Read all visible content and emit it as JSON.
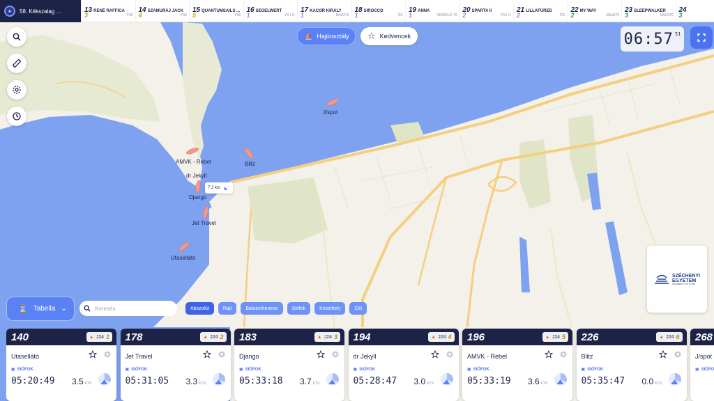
{
  "race": {
    "name": "58. Kékszalag ..."
  },
  "ranking": [
    {
      "rank": "13",
      "name": "RENÉ RAFFICA",
      "sub": "3",
      "sub_color": "#d0a420",
      "cls": "YS0"
    },
    {
      "rank": "14",
      "name": "SZAMURÁJ JACK",
      "sub": "4",
      "sub_color": "#d0a420",
      "cls": "YS0"
    },
    {
      "rank": "15",
      "name": "QUANTUMSAILS ...",
      "sub": "5",
      "sub_color": "#d0a420",
      "cls": "YS0"
    },
    {
      "rank": "16",
      "name": "SEGELWERT",
      "sub": "1",
      "sub_color": "#c470d8",
      "cls": "YS I./1"
    },
    {
      "rank": "17",
      "name": "KACOR KIRÁLY",
      "sub": "1",
      "sub_color": "#c470d8",
      "cls": "NAU370"
    },
    {
      "rank": "18",
      "name": "SIROCCO",
      "sub": "1",
      "sub_color": "#c470d8",
      "cls": "ÖC"
    },
    {
      "rank": "19",
      "name": "ANNA",
      "sub": "1",
      "sub_color": "#c470d8",
      "cls": "CIRKÁLÓ-70"
    },
    {
      "rank": "20",
      "name": "SPARTA II",
      "sub": "2",
      "sub_color": "#c470d8",
      "cls": "YS I./1"
    },
    {
      "rank": "21",
      "name": "LILLAFÜRED",
      "sub": "2",
      "sub_color": "#c470d8",
      "cls": "ÖC"
    },
    {
      "rank": "22",
      "name": "MY WAY",
      "sub": "2",
      "sub_color": "#2a9a4a",
      "cls": "NAU370"
    },
    {
      "rank": "23",
      "name": "SLEEPWALKER",
      "sub": "3",
      "sub_color": "#2a9a4a",
      "cls": "NAU370"
    },
    {
      "rank": "24",
      "name": "",
      "sub": "3",
      "sub_color": "#2a9a4a",
      "cls": ""
    }
  ],
  "controls": {
    "search_icon": "search-icon",
    "ruler_icon": "ruler-icon",
    "settings_icon": "gear-icon",
    "history_icon": "history-icon"
  },
  "top_buttons": {
    "class_label": "Hajóosztály",
    "favorites_label": "Kedvencek"
  },
  "clock": {
    "time": "06:57",
    "seconds": "51"
  },
  "map": {
    "boats": [
      {
        "label": "J/spot"
      },
      {
        "label": "AMVK - Rebel"
      },
      {
        "label": "Blitz"
      },
      {
        "label": "dr Jekyll"
      },
      {
        "label": "Django"
      },
      {
        "label": "Jet Travel"
      },
      {
        "label": "Utasellátó"
      }
    ],
    "speed_tooltip": "7.2 kts"
  },
  "sponsor": {
    "line1": "SZÉCHENYI",
    "line2": "EGYETEM",
    "line3": "UNIVERSITY OF GYŐR"
  },
  "filter": {
    "table_label": "Tabella",
    "search_placeholder": "Keresés",
    "chips": [
      {
        "label": "Abszolút",
        "active": true
      },
      {
        "label": "Rajt",
        "active": false
      },
      {
        "label": "Balatonkenese",
        "active": false
      },
      {
        "label": "Siófok",
        "active": false
      },
      {
        "label": "Keszthely",
        "active": false
      },
      {
        "label": "Cél",
        "active": false
      }
    ]
  },
  "cards": [
    {
      "sail": "140",
      "cls": "J24",
      "pos": "1",
      "name": "Utasellátó",
      "from": "SIÓFOK",
      "time": "05:20:49",
      "speed": "3.5",
      "unit": "KTS"
    },
    {
      "sail": "178",
      "cls": "J24",
      "pos": "2",
      "name": "Jet Travel",
      "from": "SIÓFOK",
      "time": "05:31:05",
      "speed": "3.3",
      "unit": "KTS"
    },
    {
      "sail": "183",
      "cls": "J24",
      "pos": "3",
      "name": "Django",
      "from": "SIÓFOK",
      "time": "05:33:18",
      "speed": "3.7",
      "unit": "KTS"
    },
    {
      "sail": "194",
      "cls": "J24",
      "pos": "4",
      "name": "dr Jekyll",
      "from": "SIÓFOK",
      "time": "05:28:47",
      "speed": "3.0",
      "unit": "KTS"
    },
    {
      "sail": "196",
      "cls": "J24",
      "pos": "5",
      "name": "AMVK - Rebel",
      "from": "SIÓFOK",
      "time": "05:33:19",
      "speed": "3.6",
      "unit": "KTS"
    },
    {
      "sail": "226",
      "cls": "J24",
      "pos": "6",
      "name": "Blitz",
      "from": "SIÓFOK",
      "time": "05:35:47",
      "speed": "0.0",
      "unit": "KTS"
    },
    {
      "sail": "268",
      "cls": "",
      "pos": "",
      "name": "J/spot",
      "from": "SIÓFOK",
      "time": "",
      "speed": "",
      "unit": ""
    }
  ]
}
